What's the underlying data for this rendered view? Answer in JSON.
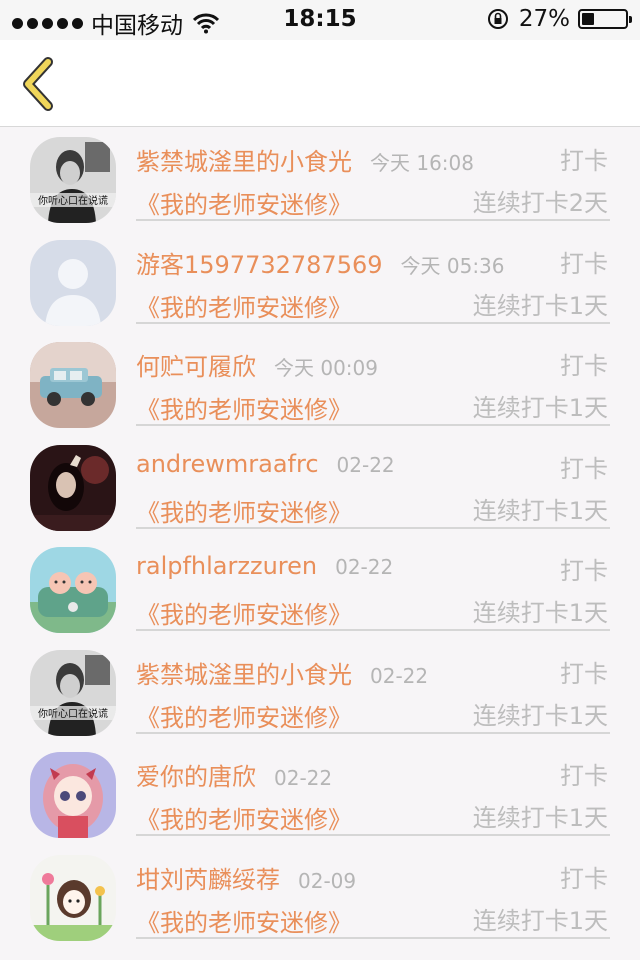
{
  "status_bar": {
    "carrier": "中国移动",
    "time": "18:15",
    "battery": "27%"
  },
  "list": {
    "items": [
      {
        "name": "紫禁城滏里的小食光",
        "time": "今天 16:08",
        "tag": "打卡",
        "book": "《我的老师安迷修》",
        "streak": "连续打卡2天",
        "avatar_icon": "avatar-photo-boy"
      },
      {
        "name": "游客1597732787569",
        "time": "今天 05:36",
        "tag": "打卡",
        "book": "《我的老师安迷修》",
        "streak": "连续打卡1天",
        "avatar_icon": "default-avatar-icon"
      },
      {
        "name": "何贮可履欣",
        "time": "今天 00:09",
        "tag": "打卡",
        "book": "《我的老师安迷修》",
        "streak": "连续打卡1天",
        "avatar_icon": "avatar-blue-car"
      },
      {
        "name": "andrewmraafrc",
        "time": "02-22",
        "tag": "打卡",
        "book": "《我的老师安迷修》",
        "streak": "连续打卡1天",
        "avatar_icon": "avatar-dark-photo"
      },
      {
        "name": "ralpfhlarzzuren",
        "time": "02-22",
        "tag": "打卡",
        "book": "《我的老师安迷修》",
        "streak": "连续打卡1天",
        "avatar_icon": "avatar-cartoon-car"
      },
      {
        "name": "紫禁城滏里的小食光",
        "time": "02-22",
        "tag": "打卡",
        "book": "《我的老师安迷修》",
        "streak": "连续打卡1天",
        "avatar_icon": "avatar-photo-boy"
      },
      {
        "name": "爱你的唐欣",
        "time": "02-22",
        "tag": "打卡",
        "book": "《我的老师安迷修》",
        "streak": "连续打卡1天",
        "avatar_icon": "avatar-anime-girl"
      },
      {
        "name": "坩刘芮麟绥荐",
        "time": "02-09",
        "tag": "打卡",
        "book": "《我的老师安迷修》",
        "streak": "连续打卡1天",
        "avatar_icon": "avatar-flower-girl"
      }
    ]
  },
  "colors": {
    "accent": "#e98f5a",
    "muted": "#bdbdbd",
    "back_arrow": "#f0d65a"
  }
}
